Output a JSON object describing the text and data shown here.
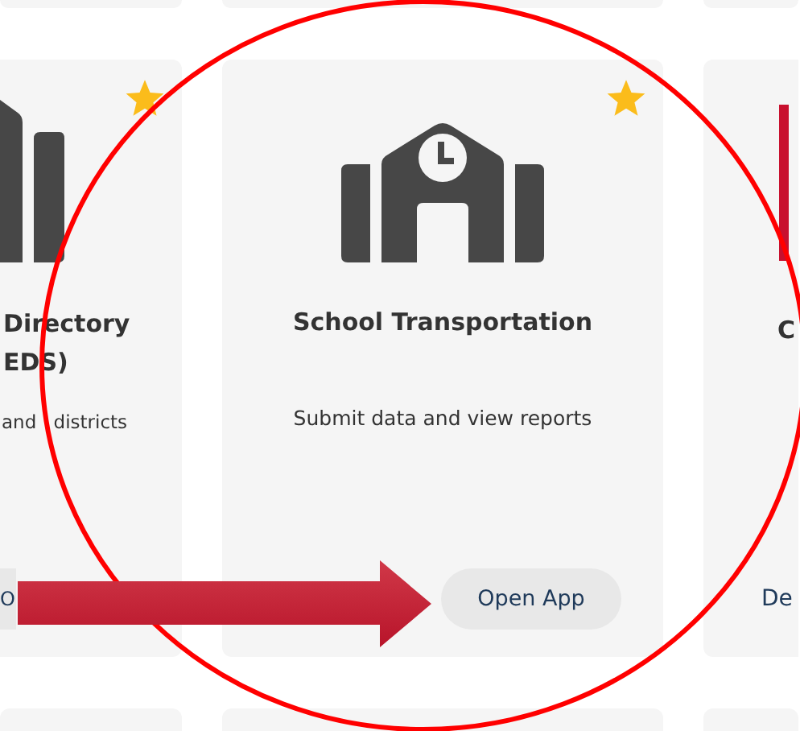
{
  "cards": [
    {
      "kind": "cut-left",
      "favorite": true,
      "title": "Directory EDS)",
      "description": "and districts",
      "button": "O"
    },
    {
      "kind": "whole",
      "favorite": true,
      "title": "School Transportation",
      "description": "Submit data and view reports",
      "button": "Open App"
    },
    {
      "kind": "cut-right",
      "title": "C",
      "button": "De"
    }
  ],
  "annotations": [
    {
      "kind": "circle"
    },
    {
      "kind": "arrow"
    }
  ]
}
